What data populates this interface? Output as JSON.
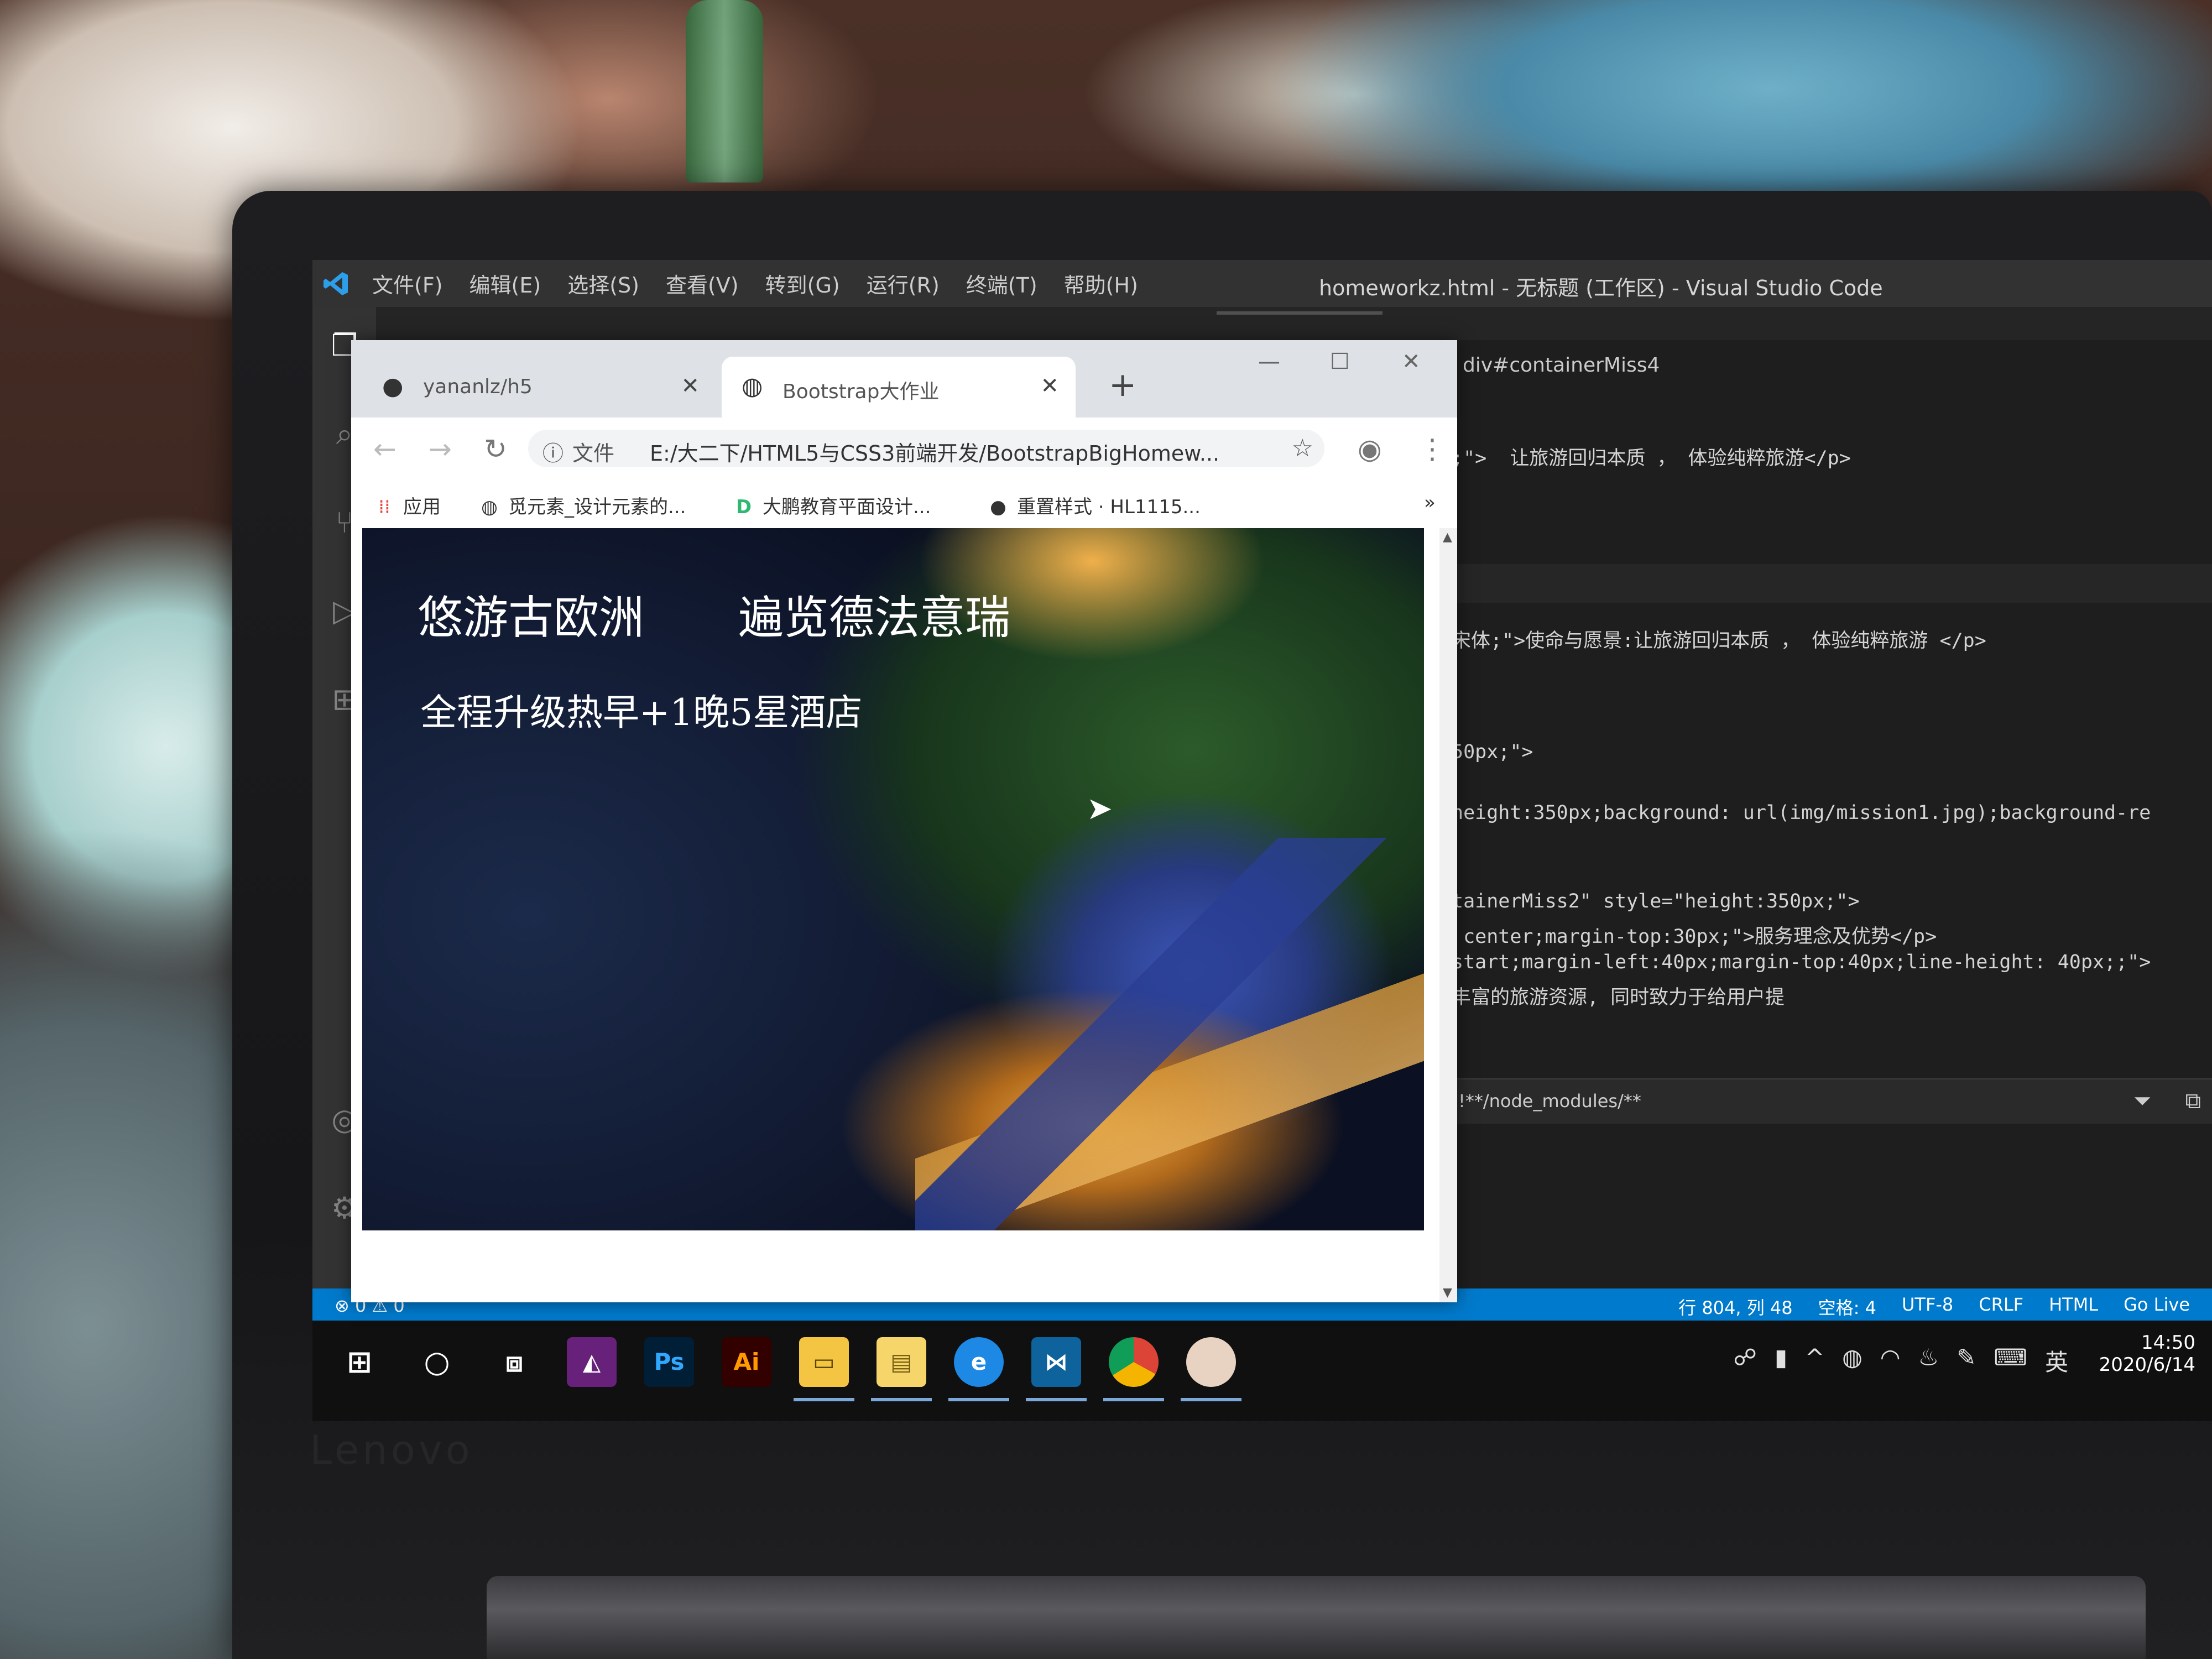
{
  "vscode": {
    "menu": [
      "文件(F)",
      "编辑(E)",
      "选择(S)",
      "查看(V)",
      "转到(G)",
      "运行(R)",
      "终端(T)",
      "帮助(H)"
    ],
    "window_title": "homeworkz.html - 无标题 (工作区) - Visual Studio Code",
    "breadcrumb": "div#containerMiss4",
    "code_lines": [
      ";\">  让旅游回归本质 ， 体验纯粹旅游</p>",
      "宋体;\">使命与愿景:让旅游回归本质 ， 体验纯粹旅游 </p>",
      "50px;\">",
      "height:350px;background: url(img/mission1.jpg);background-re",
      "tainerMiss2\" style=\"height:350px;\">",
      " center;margin-top:30px;\">服务理念及优势</p>",
      "start;margin-left:40px;margin-top:40px;line-height: 40px;;\">",
      "丰富的旅游资源, 同时致力于给用户提"
    ],
    "terminal_filter": "!**/node_modules/**",
    "status_left": "⊗ 0 ⚠ 0",
    "status_right": [
      "行 804, 列 48",
      "空格: 4",
      "UTF-8",
      "CRLF",
      "HTML",
      "Go Live"
    ]
  },
  "chrome": {
    "tabs": [
      {
        "label": "yananlz/h5",
        "icon": "github-icon",
        "active": false
      },
      {
        "label": "Bootstrap大作业",
        "icon": "globe-icon",
        "active": true
      }
    ],
    "omnibox_label": "文件",
    "url": "E:/大二下/HTML5与CSS3前端开发/BootstrapBigHomew...",
    "bookmarks": [
      {
        "label": "应用",
        "icon": "apps-grid-icon"
      },
      {
        "label": "觅元素_设计元素的...",
        "icon": "globe-icon"
      },
      {
        "label": "大鹏教育平面设计...",
        "icon": "d-logo-icon"
      },
      {
        "label": "重置样式 · HL1115...",
        "icon": "github-icon"
      }
    ],
    "bookmarks_overflow": "»"
  },
  "page": {
    "title_part1": "悠游古欧洲",
    "title_part2": "遍览德法意瑞",
    "subtitle": "全程升级热早+1晚5星酒店"
  },
  "taskbar": {
    "apps": [
      "windows-start-icon",
      "cortana-icon",
      "task-view-icon",
      "visual-studio-icon",
      "photoshop-icon",
      "illustrator-icon",
      "file-explorer-icon",
      "notepad-icon",
      "edge-icon",
      "vscode-icon",
      "chrome-icon",
      "avatar-app-icon"
    ],
    "ps_label": "Ps",
    "ai_label": "Ai",
    "ime": "英",
    "time": "14:50",
    "date": "2020/6/14"
  },
  "laptop_brand": "Lenovo",
  "colors": {
    "vscode_status": "#007acc",
    "vscode_titlebar": "#323233",
    "chrome_tabbar": "#dee1e6"
  }
}
